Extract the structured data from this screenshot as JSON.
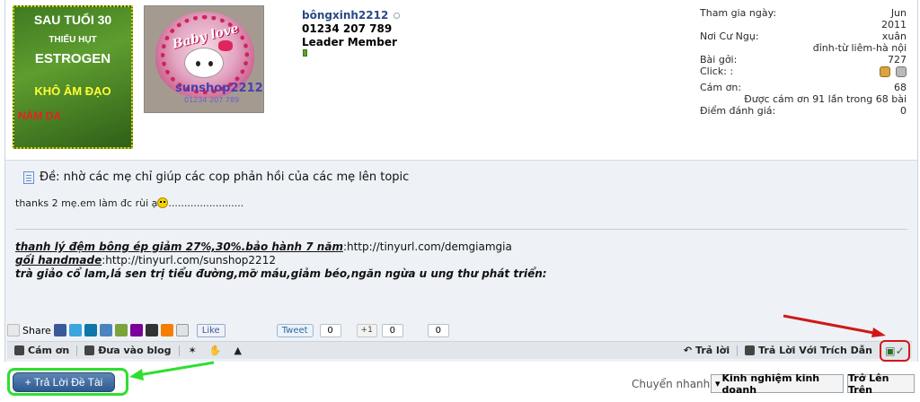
{
  "ad_banner": {
    "line1": "SAU TUỔI 30",
    "line2": "THIẾU HỤT",
    "line3": "ESTROGEN",
    "line4": "KHÔ ÂM ĐẠO",
    "line5": "NÁM DA"
  },
  "avatar": {
    "babylove_text": "Baby love",
    "watermark": "sunshop2212",
    "phone_small": "01234 207 789"
  },
  "user": {
    "name": "bôngxinh2212",
    "phone": "01234 207 789",
    "title": "Leader Member"
  },
  "info": {
    "join_label": "Tham gia ngày:",
    "join_value_line1": "Jun",
    "join_value_line2": "2011",
    "location_label": "Nơi Cư Ngụ:",
    "location_value_line1": "xuân",
    "location_value_line2": "đỉnh-từ liêm-hà nội",
    "posts_label": "Bài gởi:",
    "posts_value": "727",
    "click_label": "Click: :",
    "thanks_label": "Cám ơn:",
    "thanks_value": "68",
    "thanked_text": "Được cám ơn 91 lần trong 68 bài",
    "score_label": "Điểm đánh giá:",
    "score_value": "0"
  },
  "post": {
    "title": "Đề: nhờ các mẹ chỉ giúp các cop phản hồi của các mẹ lên topic",
    "message_pre": "thanks 2 mẹ.em làm đc rùi ạ",
    "message_post": "........................"
  },
  "signature": {
    "line1_link_text": "thanh lý đệm bông ép giảm 27%,30%.bảo hành 7 năm",
    "line1_url": ":http://tinyurl.com/demgiamgia",
    "line2_link_text": "gối handmade",
    "line2_url": ":http://tinyurl.com/sunshop2212",
    "line3": "trà giảo cổ lam,lá sen trị tiểu đường,mỡ máu,giảm béo,ngăn ngừa u ung thư phát triển:"
  },
  "share": {
    "share_label": "Share",
    "fb_like": "Like",
    "tweet": "Tweet",
    "tweet_count": "0",
    "plus_one": "+1",
    "plus_one_count": "0",
    "other_count": "0"
  },
  "actions": {
    "thanks": "Cám ơn",
    "add_blog": "Đưa vào blog",
    "reply": "Trả lời",
    "reply_quote": "Trả Lời Với Trích Dẫn"
  },
  "footer": {
    "reply_thread": "+ Trả Lời Đề Tài",
    "jump_label": "Chuyển nhanh",
    "jump_value": "Kinh nghiệm kinh doanh",
    "go_top": "Trở Lên Trên"
  },
  "colors": {
    "annotation_red": "#d01818",
    "annotation_green": "#2fdf2f",
    "username_blue": "#2a4a86"
  }
}
